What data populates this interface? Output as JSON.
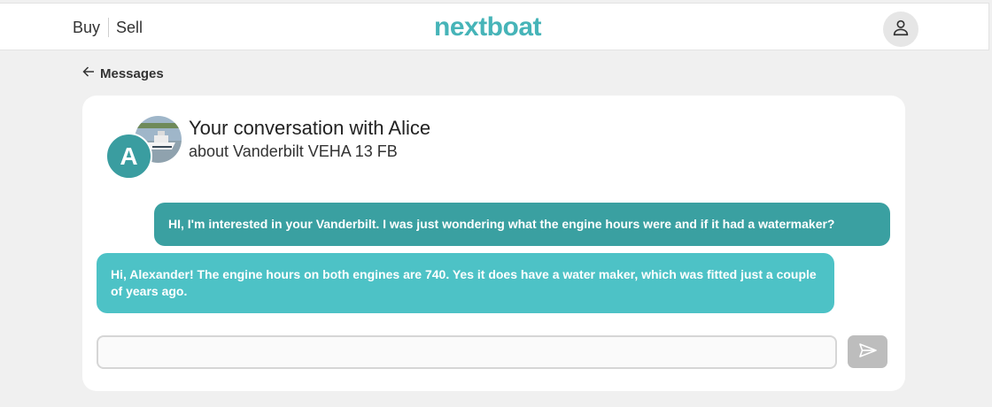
{
  "header": {
    "nav": {
      "buy_label": "Buy",
      "sell_label": "Sell"
    },
    "logo_text": "nextboat",
    "logo_color": "#46b4b8",
    "account_icon": "user-icon"
  },
  "back_link": {
    "label": "Messages",
    "icon": "arrow-left-icon"
  },
  "conversation": {
    "title": "Your conversation with Alice",
    "subtitle": "about Vanderbilt VEHA 13 FB",
    "avatar_initial": "A",
    "avatar_color": "#3a9da0"
  },
  "messages": [
    {
      "direction": "sent",
      "text": "HI, I'm interested in your Vanderbilt. I was just wondering what the engine hours were and if it had a watermaker?",
      "color": "#3aa0a1"
    },
    {
      "direction": "received",
      "text": "Hi, Alexander! The engine hours on both engines are 740. Yes it does have a water maker, which was fitted just a couple of years ago.",
      "color": "#4dc2c6"
    }
  ],
  "composer": {
    "value": "",
    "placeholder": "",
    "send_icon": "send-icon"
  }
}
